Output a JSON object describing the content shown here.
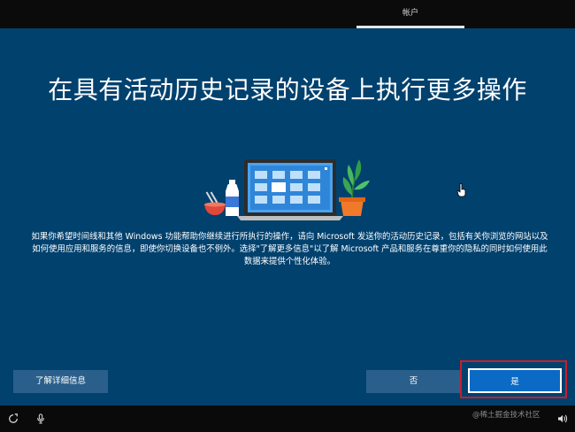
{
  "topbar": {
    "active_tab": "帐户"
  },
  "main": {
    "heading": "在具有活动历史记录的设备上执行更多操作",
    "description": "如果你希望时间线和其他 Windows 功能帮助你继续进行所执行的操作，请向 Microsoft 发送你的活动历史记录，包括有关你浏览的网站以及\n如何使用应用和服务的信息，即使你切换设备也不例外。选择\"了解更多信息\"以了解 Microsoft 产品和服务在尊重你的隐私的同时如何使用此\n数据来提供个性化体验。"
  },
  "buttons": {
    "learn_more": "了解详细信息",
    "no": "否",
    "yes": "是"
  },
  "taskbar": {
    "icons": [
      "ease-of-access-icon",
      "microphone-icon",
      "volume-icon"
    ]
  },
  "watermark": "@稀土掘金技术社区",
  "colors": {
    "background": "#01416e",
    "button": "#2b5f8b",
    "primary_button": "#0a6ac6",
    "highlight_border": "#c81e2a",
    "topbar": "#0b0b0b"
  }
}
